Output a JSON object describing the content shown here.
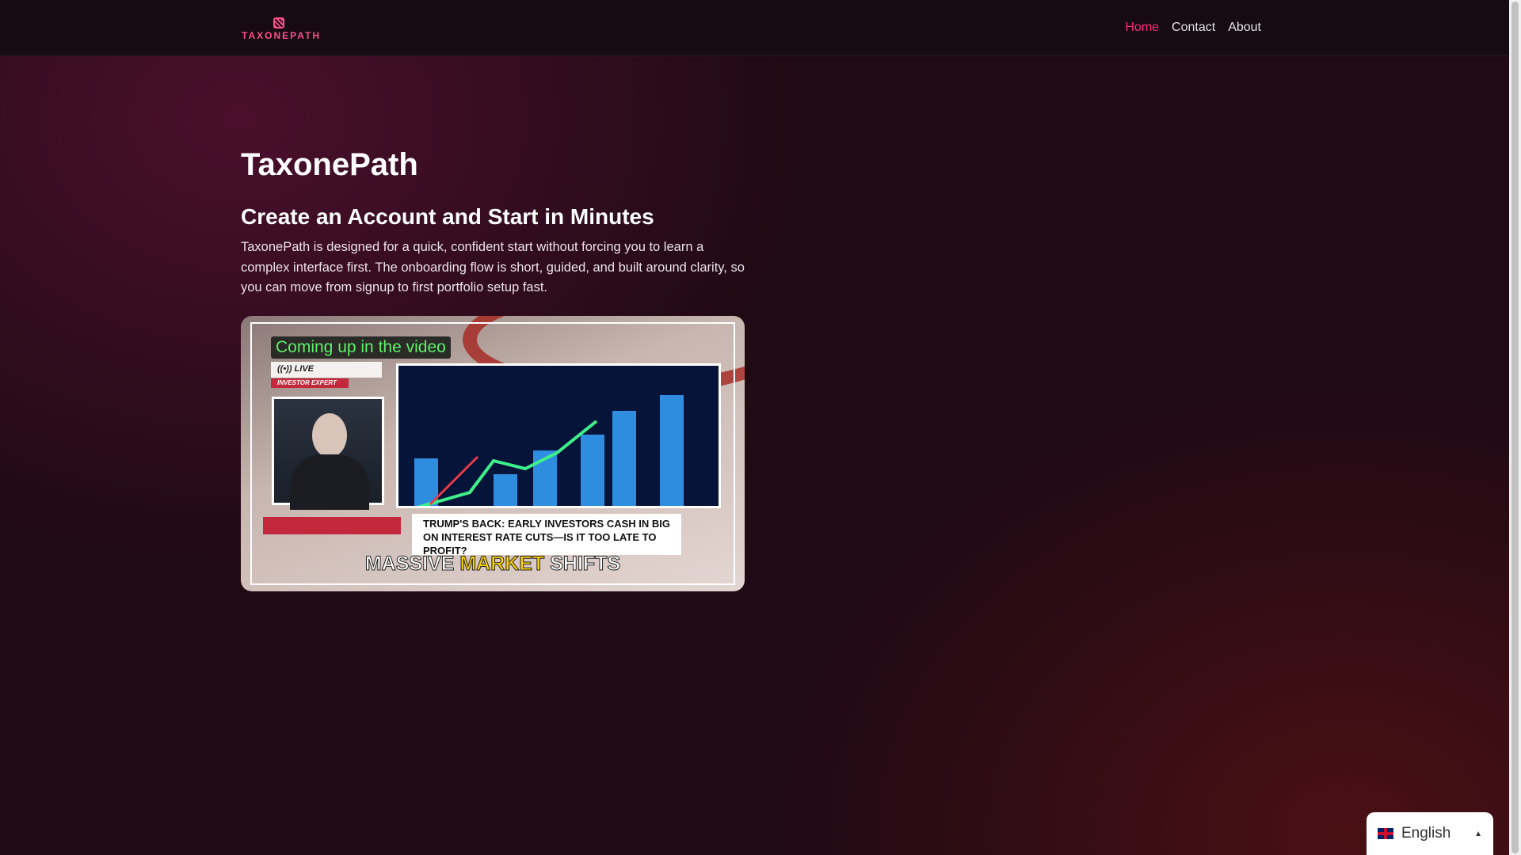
{
  "header": {
    "logo_text": "TAXONEPATH",
    "nav": [
      {
        "label": "Home",
        "active": true
      },
      {
        "label": "Contact"
      },
      {
        "label": "About"
      }
    ]
  },
  "main": {
    "title": "TaxonePath",
    "subtitle": "Create an Account and Start in Minutes",
    "paragraph": "TaxonePath is designed for a quick, confident start without forcing you to learn a complex interface first. The onboarding flow is short, guided, and built around clarity, so you can move from signup to first portfolio setup fast.",
    "video": {
      "coming": "Coming up in the video",
      "live": "((•)) LIVE",
      "expert": "INVESTOR EXPERT",
      "headline": "TRUMP'S BACK: EARLY INVESTORS CASH IN BIG ON INTEREST RATE CUTS—IS IT TOO LATE TO PROFIT?",
      "massive_a": "MASSIVE ",
      "massive_b": "MARKET",
      "massive_c": " SHIFTS"
    }
  },
  "language": {
    "selected": "English",
    "caret": "▲"
  },
  "colors": {
    "accent": "#ff2a7a",
    "logo": "#ff4f8b"
  }
}
